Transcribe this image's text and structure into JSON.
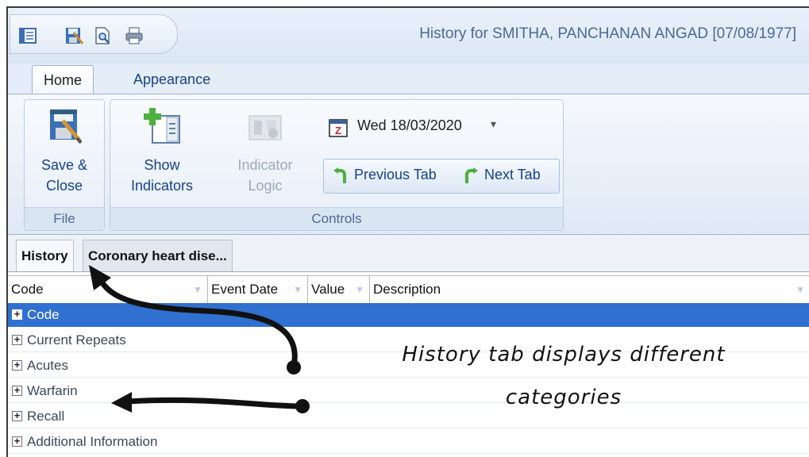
{
  "window": {
    "title": "History for SMITHA, PANCHANAN ANGAD [07/08/1977]",
    "qat_icons": [
      "app-menu-icon",
      "save-icon",
      "print-preview-icon",
      "print-icon"
    ]
  },
  "ribbon": {
    "tabs": [
      {
        "label": "Home",
        "active": true
      },
      {
        "label": "Appearance",
        "active": false
      }
    ],
    "groups": {
      "file": {
        "label": "File",
        "save_close": "Save &\nClose"
      },
      "controls": {
        "label": "Controls",
        "show_indicators": "Show\nIndicators",
        "indicator_logic": "Indicator\nLogic",
        "date": "Wed 18/03/2020",
        "previous_tab": "Previous Tab",
        "next_tab": "Next Tab"
      }
    }
  },
  "doc_tabs": [
    {
      "label": "History",
      "active": true
    },
    {
      "label": "Coronary heart dise...",
      "active": false
    }
  ],
  "grid": {
    "columns": [
      "Code",
      "Event Date",
      "Value",
      "Description"
    ],
    "rows": [
      {
        "label": "Code",
        "selected": true
      },
      {
        "label": "Current Repeats",
        "selected": false
      },
      {
        "label": "Acutes",
        "selected": false
      },
      {
        "label": "Warfarin",
        "selected": false
      },
      {
        "label": "Recall",
        "selected": false
      },
      {
        "label": "Additional Information",
        "selected": false
      }
    ]
  },
  "annotation": {
    "line1": "History tab displays different",
    "line2": "categories"
  },
  "colors": {
    "selection": "#3070d0",
    "ribbon_text": "#15428b",
    "window_bg": "#e4edf8"
  }
}
